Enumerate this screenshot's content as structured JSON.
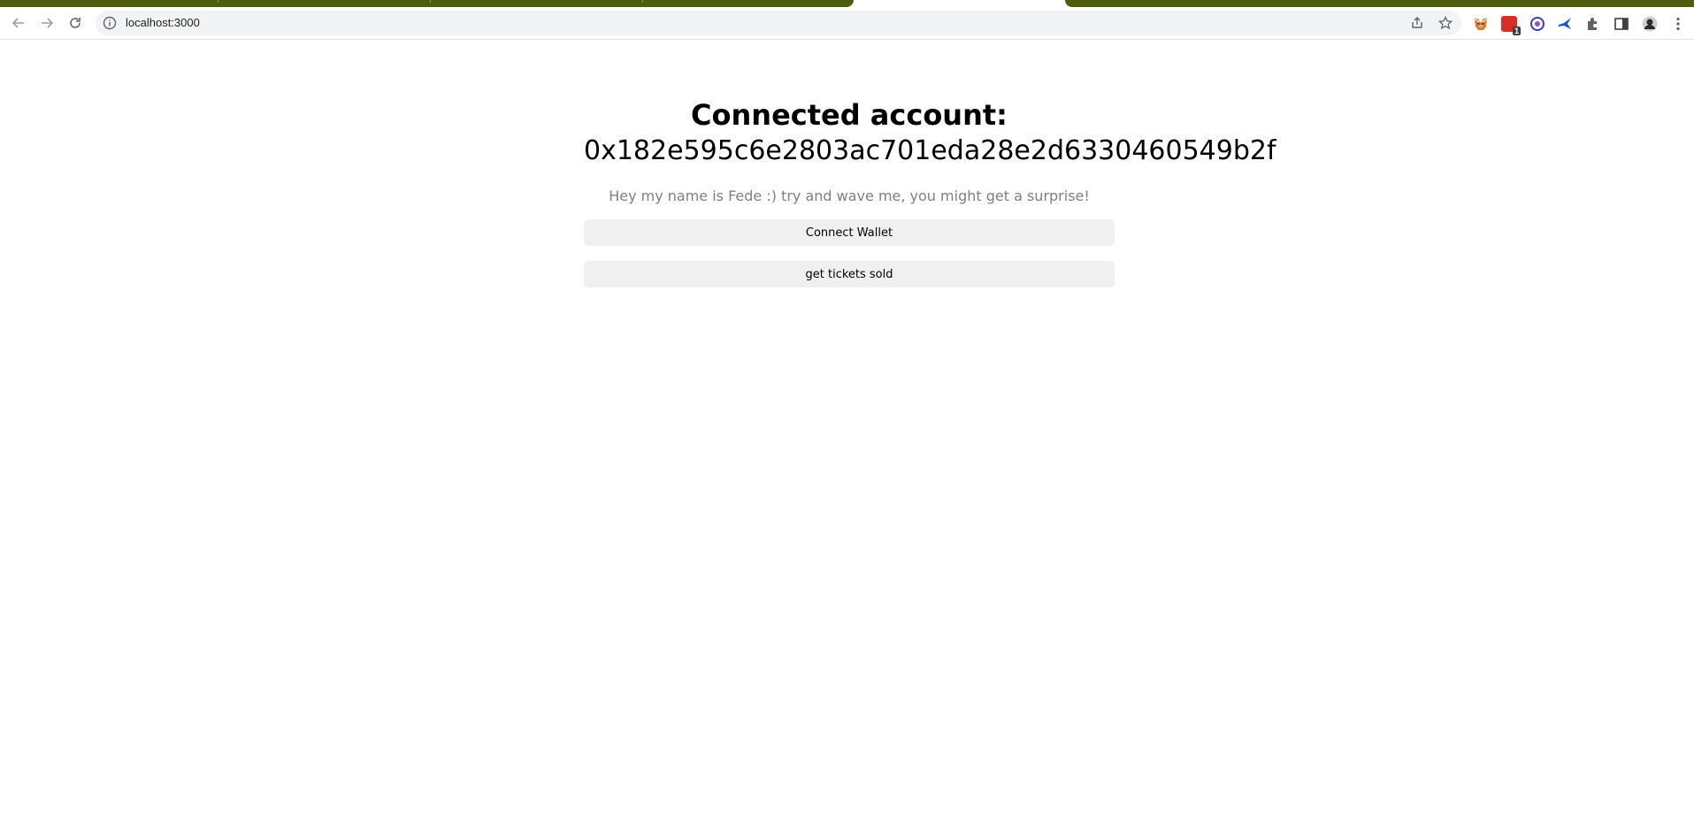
{
  "browser": {
    "url": "localhost:3000",
    "extension_badge": "1"
  },
  "main": {
    "heading_label": "Connected account:",
    "account_address": "0x182e595c6e2803ac701eda28e2d6330460549b2f",
    "bio": "Hey my name is Fede :) try and wave me, you might get a surprise!",
    "connect_button_label": "Connect Wallet",
    "tickets_button_label": "get tickets sold"
  },
  "colors": {
    "tab_accent": "#4e5d12",
    "button_bg": "#f0f0f0",
    "bio_text": "#808080"
  }
}
